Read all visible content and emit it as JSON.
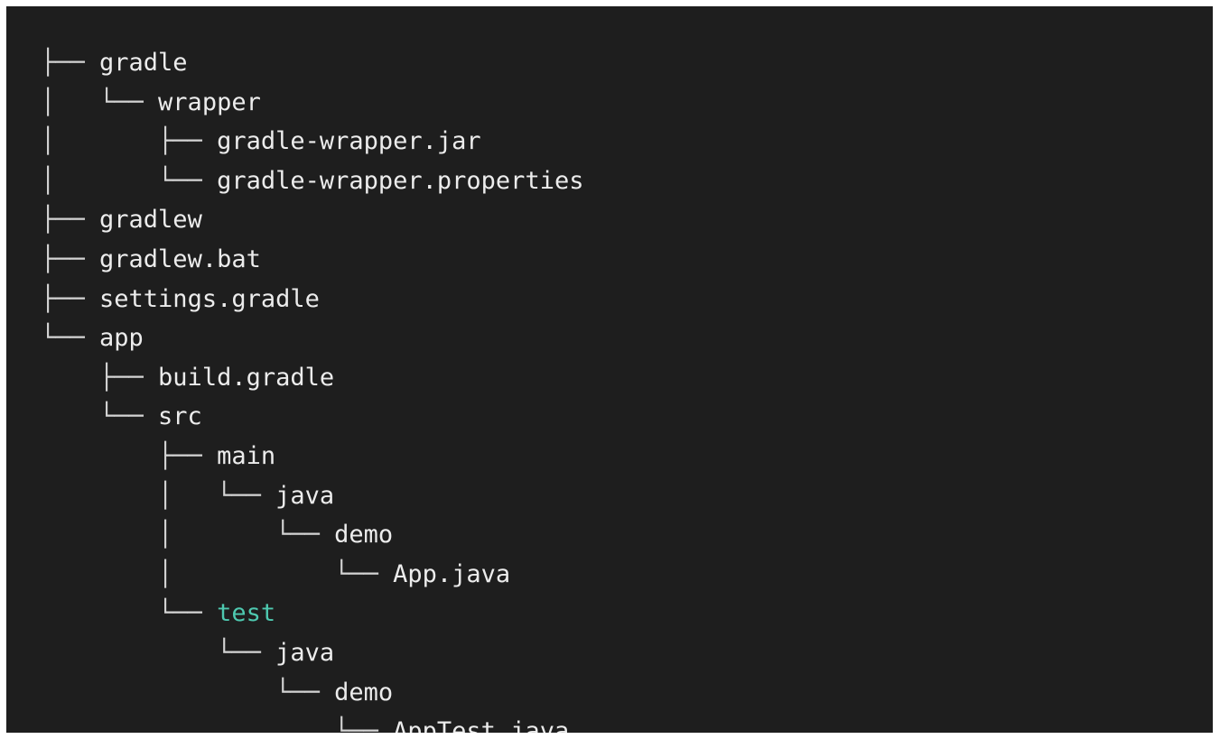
{
  "colors": {
    "background": "#1e1e1e",
    "text": "#ececec",
    "highlight": "#4ec9b0"
  },
  "tree": [
    {
      "prefix": "├── ",
      "name": "gradle"
    },
    {
      "prefix": "│   └── ",
      "name": "wrapper"
    },
    {
      "prefix": "│       ├── ",
      "name": "gradle-wrapper.jar"
    },
    {
      "prefix": "│       └── ",
      "name": "gradle-wrapper.properties"
    },
    {
      "prefix": "├── ",
      "name": "gradlew"
    },
    {
      "prefix": "├── ",
      "name": "gradlew.bat"
    },
    {
      "prefix": "├── ",
      "name": "settings.gradle"
    },
    {
      "prefix": "└── ",
      "name": "app"
    },
    {
      "prefix": "    ├── ",
      "name": "build.gradle"
    },
    {
      "prefix": "    └── ",
      "name": "src"
    },
    {
      "prefix": "        ├── ",
      "name": "main"
    },
    {
      "prefix": "        │   └── ",
      "name": "java"
    },
    {
      "prefix": "        │       └── ",
      "name": "demo"
    },
    {
      "prefix": "        │           └── ",
      "name": "App.java"
    },
    {
      "prefix": "        └── ",
      "name": "test",
      "highlight": true
    },
    {
      "prefix": "            └── ",
      "name": "java"
    },
    {
      "prefix": "                └── ",
      "name": "demo"
    },
    {
      "prefix": "                    └── ",
      "name": "AppTest.java"
    }
  ]
}
